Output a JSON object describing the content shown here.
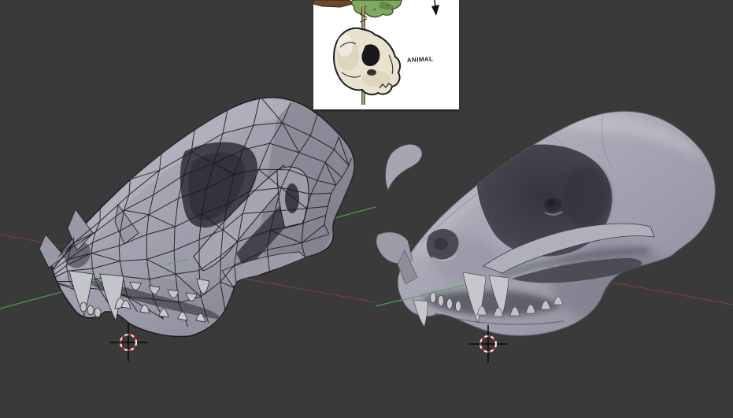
{
  "scene": {
    "background_color": "#3a3a3b",
    "axis": {
      "y_color": "#4fa14f",
      "x_color": "#9c4343"
    },
    "cursor": {
      "ring_red": "#b42828",
      "ring_white": "#efefef",
      "cross_black": "#0a0a0a"
    },
    "objects": {
      "left": {
        "type": "wireframe-skull-mesh"
      },
      "right": {
        "type": "sculpted-skull-mesh"
      }
    }
  },
  "reference_image": {
    "annotation": "ANIMAL",
    "background": "#ffffff"
  }
}
